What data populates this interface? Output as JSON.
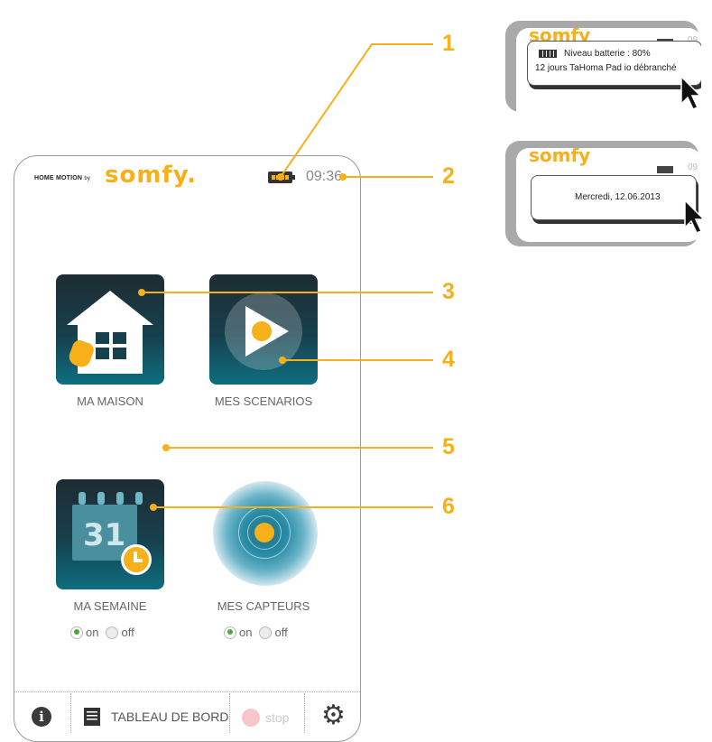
{
  "header": {
    "brand_small": "HOME MOTION",
    "brand_by": "by",
    "brand_logo": "somfy.",
    "time": "09:36"
  },
  "tiles": [
    {
      "label": "MA MAISON"
    },
    {
      "label": "MES SCENARIOS"
    },
    {
      "label": "MA SEMAINE",
      "icon_text": "31"
    },
    {
      "label": "MES CAPTEURS"
    }
  ],
  "toggles": {
    "on_label": "on",
    "off_label": "off"
  },
  "bottom_bar": {
    "info_glyph": "i",
    "dashboard_label": "TABLEAU DE BORD",
    "stop_label": "stop",
    "gear_glyph": "⚙"
  },
  "callouts": [
    "1",
    "2",
    "3",
    "4",
    "5",
    "6"
  ],
  "inset_battery": {
    "logo": "somfy",
    "time_fragment": "09",
    "line1": "Niveau batterie : 80%",
    "line2": "12 jours TaHoma Pad io débranché"
  },
  "inset_date": {
    "logo": "somfy",
    "time_fragment": "09",
    "text": "Mercredi, 12.06.2013"
  },
  "colors": {
    "accent": "#f7b01a",
    "tile_dark": "#1e2c33",
    "tile_teal": "#0e6e80",
    "on_green": "#4caa3a",
    "stop_pink": "#f6c6cc"
  }
}
